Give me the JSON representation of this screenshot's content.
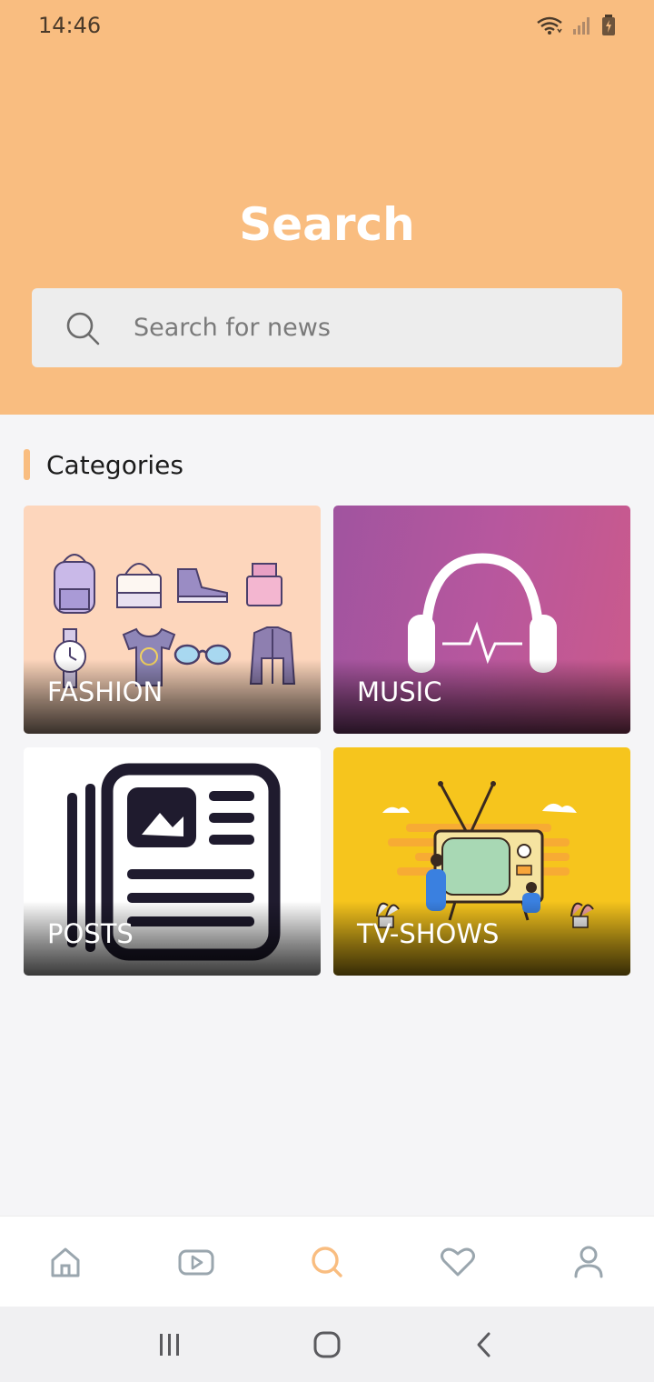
{
  "status_bar": {
    "time": "14:46",
    "icons": [
      "wifi-icon",
      "signal-icon",
      "battery-charging-icon"
    ]
  },
  "header": {
    "title": "Search",
    "background_color": "#f9bd80"
  },
  "search": {
    "placeholder": "Search for news",
    "value": ""
  },
  "categories": {
    "title": "Categories",
    "accent_color": "#f9bd80",
    "items": [
      {
        "label": "FASHION",
        "icon": "fashion-items-illustration"
      },
      {
        "label": "MUSIC",
        "icon": "headphones-icon"
      },
      {
        "label": "POSTS",
        "icon": "newspaper-icon"
      },
      {
        "label": "TV-SHOWS",
        "icon": "retro-tv-illustration"
      }
    ]
  },
  "bottom_nav": {
    "active_index": 2,
    "active_color": "#f9bd80",
    "inactive_color": "#9aa6ae",
    "items": [
      "home-icon",
      "video-play-icon",
      "search-icon",
      "heart-icon",
      "user-icon"
    ]
  },
  "system_nav": [
    "recent-apps-icon",
    "home-circle-icon",
    "back-icon"
  ]
}
